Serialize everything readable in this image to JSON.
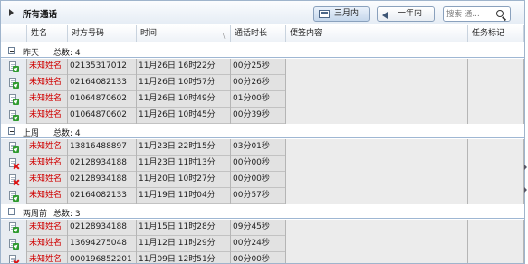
{
  "title": "所有通话",
  "filters": {
    "three_months": "三月内",
    "one_year": "一年内"
  },
  "search": {
    "placeholder": "搜索 通…"
  },
  "columns": [
    "姓名",
    "对方号码",
    "时间",
    "通话时长",
    "便签内容",
    "任务标记"
  ],
  "groups": [
    {
      "name": "昨天",
      "count_label": "总数: 4",
      "rows": [
        {
          "icon": "incoming-call-icon",
          "name": "未知姓名",
          "number": "02135317012",
          "time": "11月26日 16时22分",
          "duration": "00分25秒",
          "note": "",
          "task": ""
        },
        {
          "icon": "incoming-call-icon",
          "name": "未知姓名",
          "number": "02164082133",
          "time": "11月26日 10时57分",
          "duration": "00分26秒",
          "note": "",
          "task": ""
        },
        {
          "icon": "incoming-call-icon",
          "name": "未知姓名",
          "number": "01064870602",
          "time": "11月26日 10时49分",
          "duration": "01分00秒",
          "note": "",
          "task": ""
        },
        {
          "icon": "incoming-call-icon",
          "name": "未知姓名",
          "number": "01064870602",
          "time": "11月26日 10时45分",
          "duration": "00分39秒",
          "note": "",
          "task": ""
        }
      ]
    },
    {
      "name": "上周",
      "count_label": "总数: 4",
      "rows": [
        {
          "icon": "incoming-call-icon",
          "name": "未知姓名",
          "number": "13816488897",
          "time": "11月23日 22时15分",
          "duration": "03分01秒",
          "note": "",
          "task": ""
        },
        {
          "icon": "missed-call-icon",
          "name": "未知姓名",
          "number": "02128934188",
          "time": "11月23日 11时13分",
          "duration": "00分00秒",
          "note": "",
          "task": ""
        },
        {
          "icon": "missed-call-icon",
          "name": "未知姓名",
          "number": "02128934188",
          "time": "11月20日 10时27分",
          "duration": "00分00秒",
          "note": "",
          "task": ""
        },
        {
          "icon": "incoming-call-icon",
          "name": "未知姓名",
          "number": "02164082133",
          "time": "11月19日 11时04分",
          "duration": "00分57秒",
          "note": "",
          "task": ""
        }
      ]
    },
    {
      "name": "两周前",
      "count_label": "总数: 3",
      "rows": [
        {
          "icon": "incoming-call-icon",
          "name": "未知姓名",
          "number": "02128934188",
          "time": "11月15日 11时28分",
          "duration": "09分45秒",
          "note": "",
          "task": ""
        },
        {
          "icon": "incoming-call-icon",
          "name": "未知姓名",
          "number": "13694275048",
          "time": "11月12日 11时29分",
          "duration": "00分24秒",
          "note": "",
          "task": ""
        },
        {
          "icon": "missed-call-icon",
          "name": "未知姓名",
          "number": "000196852201",
          "time": "11月09日 12时51分",
          "duration": "00分00秒",
          "note": "",
          "task": ""
        }
      ]
    }
  ],
  "colors": {
    "unknown_name": "#d00000",
    "missed": "#d11111",
    "incoming": "#2f9a2f"
  }
}
